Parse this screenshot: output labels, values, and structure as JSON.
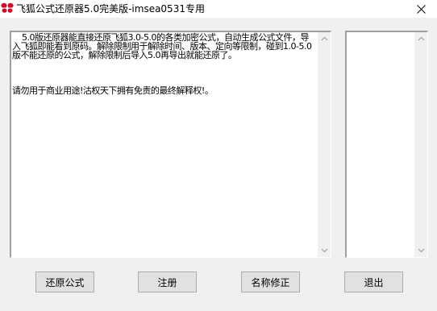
{
  "window": {
    "title": "飞狐公式还原器5.0完美版-imsea0531专用",
    "app_icon": "butterfly-logo-icon",
    "close_icon": "close-icon"
  },
  "main_text": {
    "content": "    5.0版还原器能直接还原飞狐3.0-5.0的各类加密公式，自动生成公式文件，导入飞狐即能看到原码。解除限制用于解除时间、版本、定向等限制，碰到1.0-5.0版不能还原的公式，解除限制后导入5.0再导出就能还原了。\n\n\n\n请勿用于商业用途!沽权天下拥有免责的最终解释权!。"
  },
  "side_text": {
    "content": ""
  },
  "scrollbar": {
    "up_icon": "chevron-up-icon",
    "down_icon": "chevron-down-icon"
  },
  "buttons": {
    "restore": "还原公式",
    "register": "注册",
    "rename": "名称修正",
    "exit": "退出"
  }
}
